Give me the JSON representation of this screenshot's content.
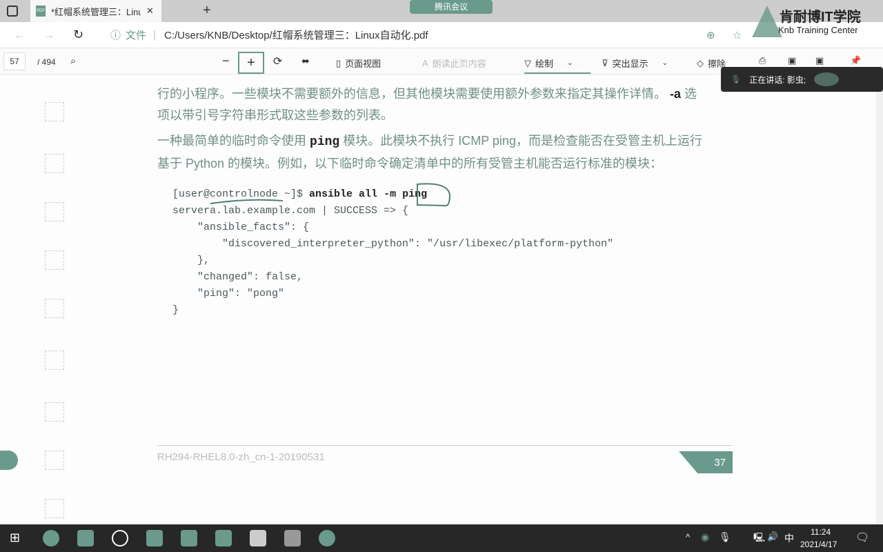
{
  "browser": {
    "tab_title": "*红帽系统管理三：Linux自动化.pdf",
    "new_tab": "+",
    "file_label": "文件",
    "url": "C:/Users/KNB/Desktop/红帽系统管理三：Linux自动化.pdf"
  },
  "overlay": {
    "meeting": "腾讯会议",
    "logo_cn": "肯耐博IT学院",
    "logo_en": "Knb Training Center",
    "speaking": "正在讲话: 影虫;"
  },
  "pdf_toolbar": {
    "page_current": "57",
    "page_total": "/ 494",
    "page_view": "页面视图",
    "read_aloud": "朗读此页内容",
    "draw": "绘制",
    "highlight": "突出显示",
    "erase": "擦除"
  },
  "doc": {
    "para1_line1": "行的小程序。一些模块不需要额外的信息，但其他模块需要使用额外参数来指定其操作详情。",
    "para1_flag": "-a",
    "para1_tail": "选",
    "para1_line2": "项以带引号字符串形式取这些参数的列表。",
    "para2_a": "一种最简单的临时命令使用",
    "para2_code": "ping",
    "para2_b": "模块。此模块不执行 ICMP ping，而是检查能否在受管主机上运行",
    "para2_line2": "基于 Python 的模块。例如，以下临时命令确定清单中的所有受管主机能否运行标准的模块：",
    "prompt": "[user@controlnode ~]$ ",
    "command": "ansible all -m ping",
    "output": [
      "servera.lab.example.com | SUCCESS => {",
      "    \"ansible_facts\": {",
      "        \"discovered_interpreter_python\": \"/usr/libexec/platform-python\"",
      "    },",
      "    \"changed\": false,",
      "    \"ping\": \"pong\"",
      "}"
    ],
    "footer_id": "RH294-RHEL8.0-zh_cn-1-20190531",
    "page_number": "37"
  },
  "taskbar": {
    "time": "11:24",
    "date": "2021/4/17",
    "ime": "中"
  },
  "colors": {
    "accent": "#6a9a8c",
    "taskbar": "#272727"
  }
}
